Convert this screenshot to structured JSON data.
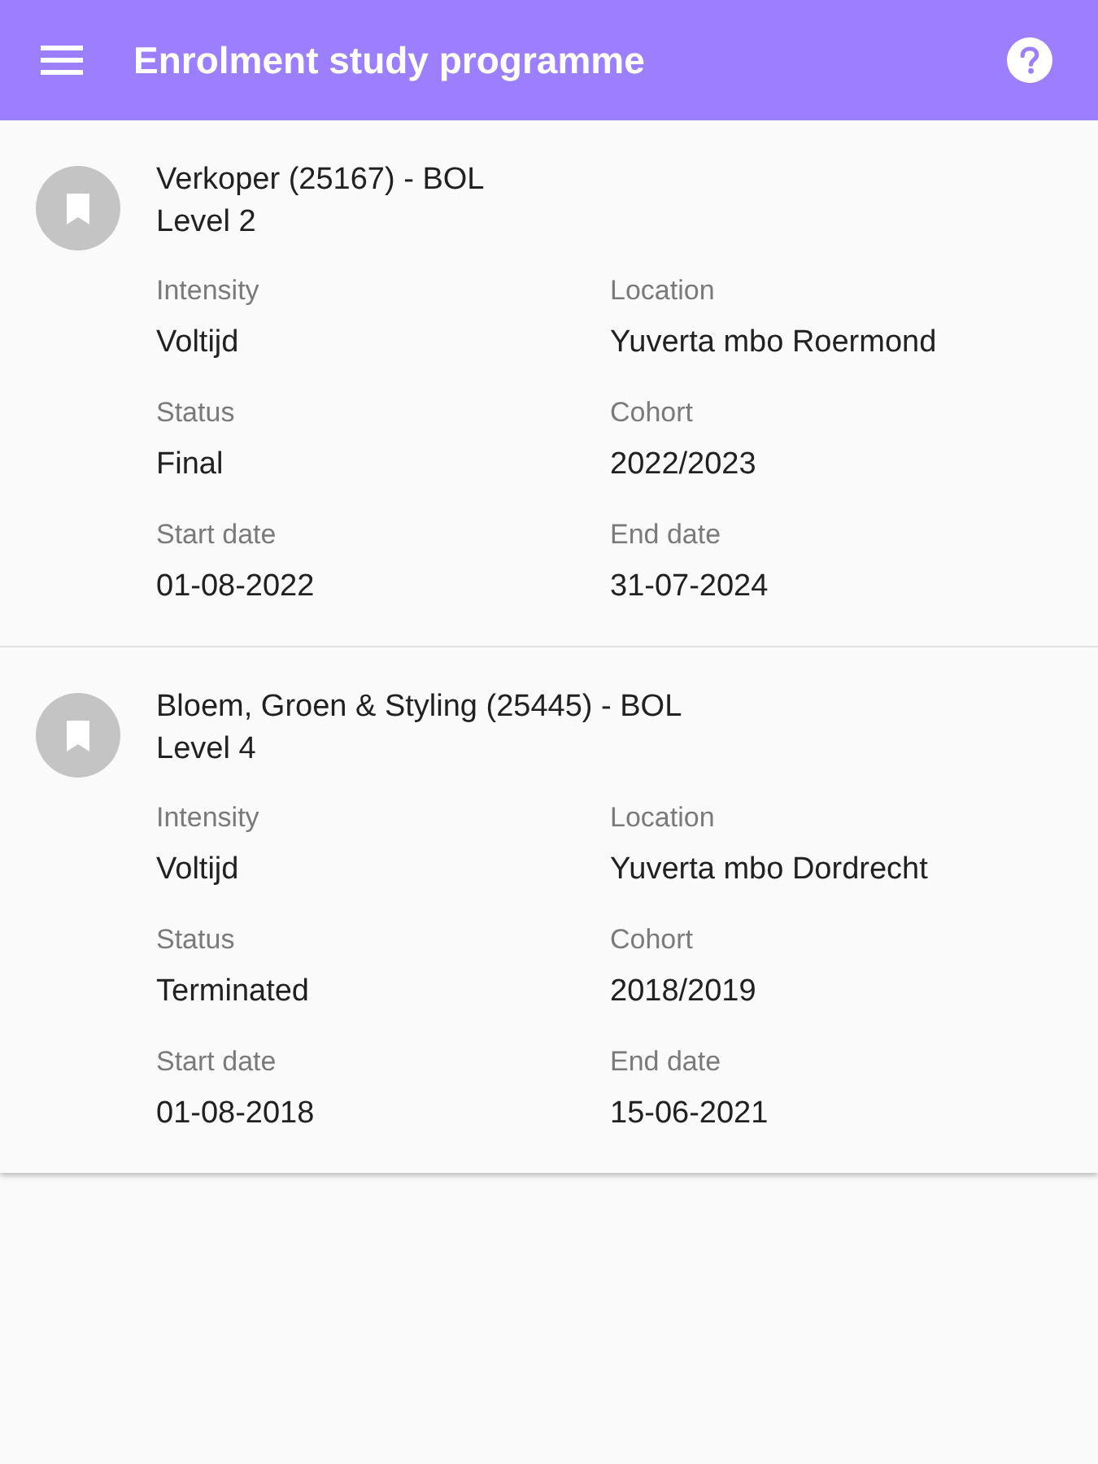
{
  "app_bar": {
    "title": "Enrolment study programme"
  },
  "enrolments": [
    {
      "title": "Verkoper (25167) - BOL",
      "level": "Level 2",
      "fields": [
        {
          "label": "Intensity",
          "value": "Voltijd"
        },
        {
          "label": "Location",
          "value": "Yuverta mbo Roermond"
        },
        {
          "label": "Status",
          "value": "Final"
        },
        {
          "label": "Cohort",
          "value": "2022/2023"
        },
        {
          "label": "Start date",
          "value": "01-08-2022"
        },
        {
          "label": "End date",
          "value": "31-07-2024"
        }
      ]
    },
    {
      "title": "Bloem, Groen & Styling (25445) - BOL",
      "level": "Level 4",
      "fields": [
        {
          "label": "Intensity",
          "value": "Voltijd"
        },
        {
          "label": "Location",
          "value": "Yuverta mbo Dordrecht"
        },
        {
          "label": "Status",
          "value": "Terminated"
        },
        {
          "label": "Cohort",
          "value": "2018/2019"
        },
        {
          "label": "Start date",
          "value": "01-08-2018"
        },
        {
          "label": "End date",
          "value": "15-06-2021"
        }
      ]
    }
  ]
}
